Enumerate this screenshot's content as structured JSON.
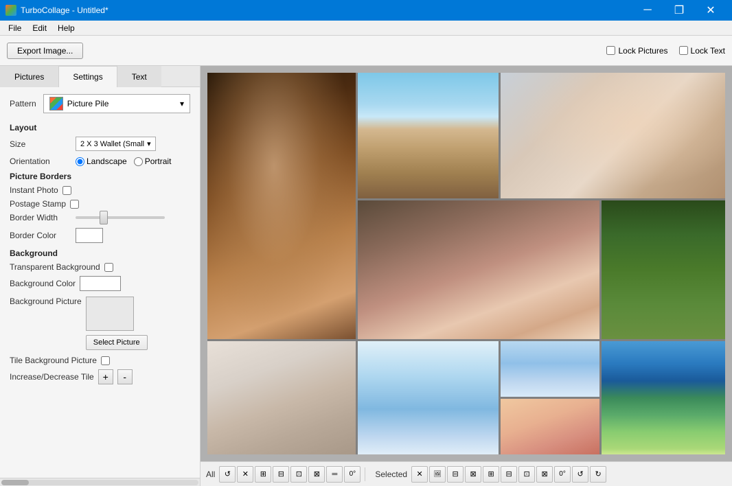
{
  "titlebar": {
    "title": "TurboCollage - Untitled*",
    "app_icon": "turbocollage-icon",
    "minimize_label": "─",
    "restore_label": "❐",
    "close_label": "✕"
  },
  "menubar": {
    "items": [
      "File",
      "Edit",
      "Help"
    ]
  },
  "toolbar": {
    "export_label": "Export Image...",
    "lock_pictures_label": "Lock Pictures",
    "lock_text_label": "Lock Text"
  },
  "tabs": {
    "pictures_label": "Pictures",
    "settings_label": "Settings",
    "text_label": "Text"
  },
  "settings_panel": {
    "pattern_label": "Pattern",
    "pattern_value": "Picture Pile",
    "layout_header": "Layout",
    "size_label": "Size",
    "size_value": "2 X 3 Wallet (Small ▾",
    "orientation_label": "Orientation",
    "landscape_label": "Landscape",
    "portrait_label": "Portrait",
    "picture_borders_header": "Picture Borders",
    "instant_photo_label": "Instant Photo",
    "postage_stamp_label": "Postage Stamp",
    "border_width_label": "Border Width",
    "border_color_label": "Border Color",
    "background_header": "Background",
    "transparent_bg_label": "Transparent Background",
    "bg_color_label": "Background Color",
    "bg_picture_label": "Background Picture",
    "select_picture_btn": "Select Picture",
    "tile_bg_label": "Tile Background Picture",
    "inc_dec_label": "Increase/Decrease Tile",
    "inc_label": "+",
    "dec_label": "-"
  },
  "bottom_toolbar": {
    "all_label": "All",
    "selected_label": "Selected",
    "btns": [
      "↺",
      "✕",
      "⊞",
      "⊟",
      "⊡",
      "⊠",
      "═",
      "0°",
      "✕",
      "🖼",
      "⊟",
      "⊠",
      "⊞",
      "⊟",
      "⊡",
      "⊠",
      "0°",
      "↺",
      "↻"
    ]
  }
}
